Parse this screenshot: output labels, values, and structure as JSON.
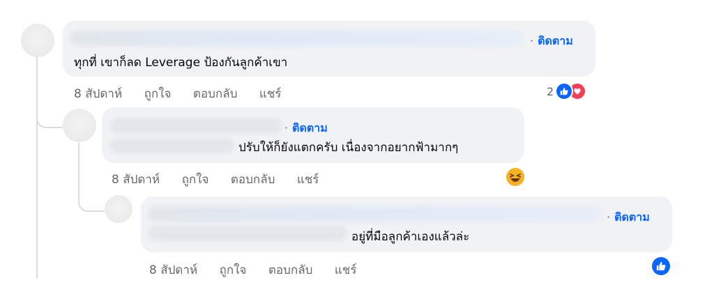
{
  "comments": [
    {
      "follow_label": "ติดตาม",
      "text": "ทุกที่ เขาก็ลด Leverage ป้องกันลูกค้าเขา",
      "time": "8 สัปดาห์",
      "like": "ถูกใจ",
      "reply": "ตอบกลับ",
      "share": "แชร์",
      "reaction_count": "2",
      "reactions": [
        "like-icon",
        "love-icon"
      ]
    },
    {
      "follow_label": "ติดตาม",
      "text": "ปรับให้ก็ยังแตกครับ เนื่องจากอยากฟ้ามากๆ",
      "time": "8 สัปดาห์",
      "like": "ถูกใจ",
      "reply": "ตอบกลับ",
      "share": "แชร์",
      "reactions": [
        "haha-icon"
      ]
    },
    {
      "follow_label": "ติดตาม",
      "text": "อยู่ที่มือลูกค้าเองแล้วล่ะ",
      "time": "8 สัปดาห์",
      "like": "ถูกใจ",
      "reply": "ตอบกลับ",
      "share": "แชร์",
      "reactions": [
        "like-icon"
      ]
    }
  ],
  "colors": {
    "accent": "#0866ff",
    "bubble": "#f0f2f5",
    "meta": "#65676b",
    "love": "#f33e58",
    "haha": "#f7b125"
  }
}
